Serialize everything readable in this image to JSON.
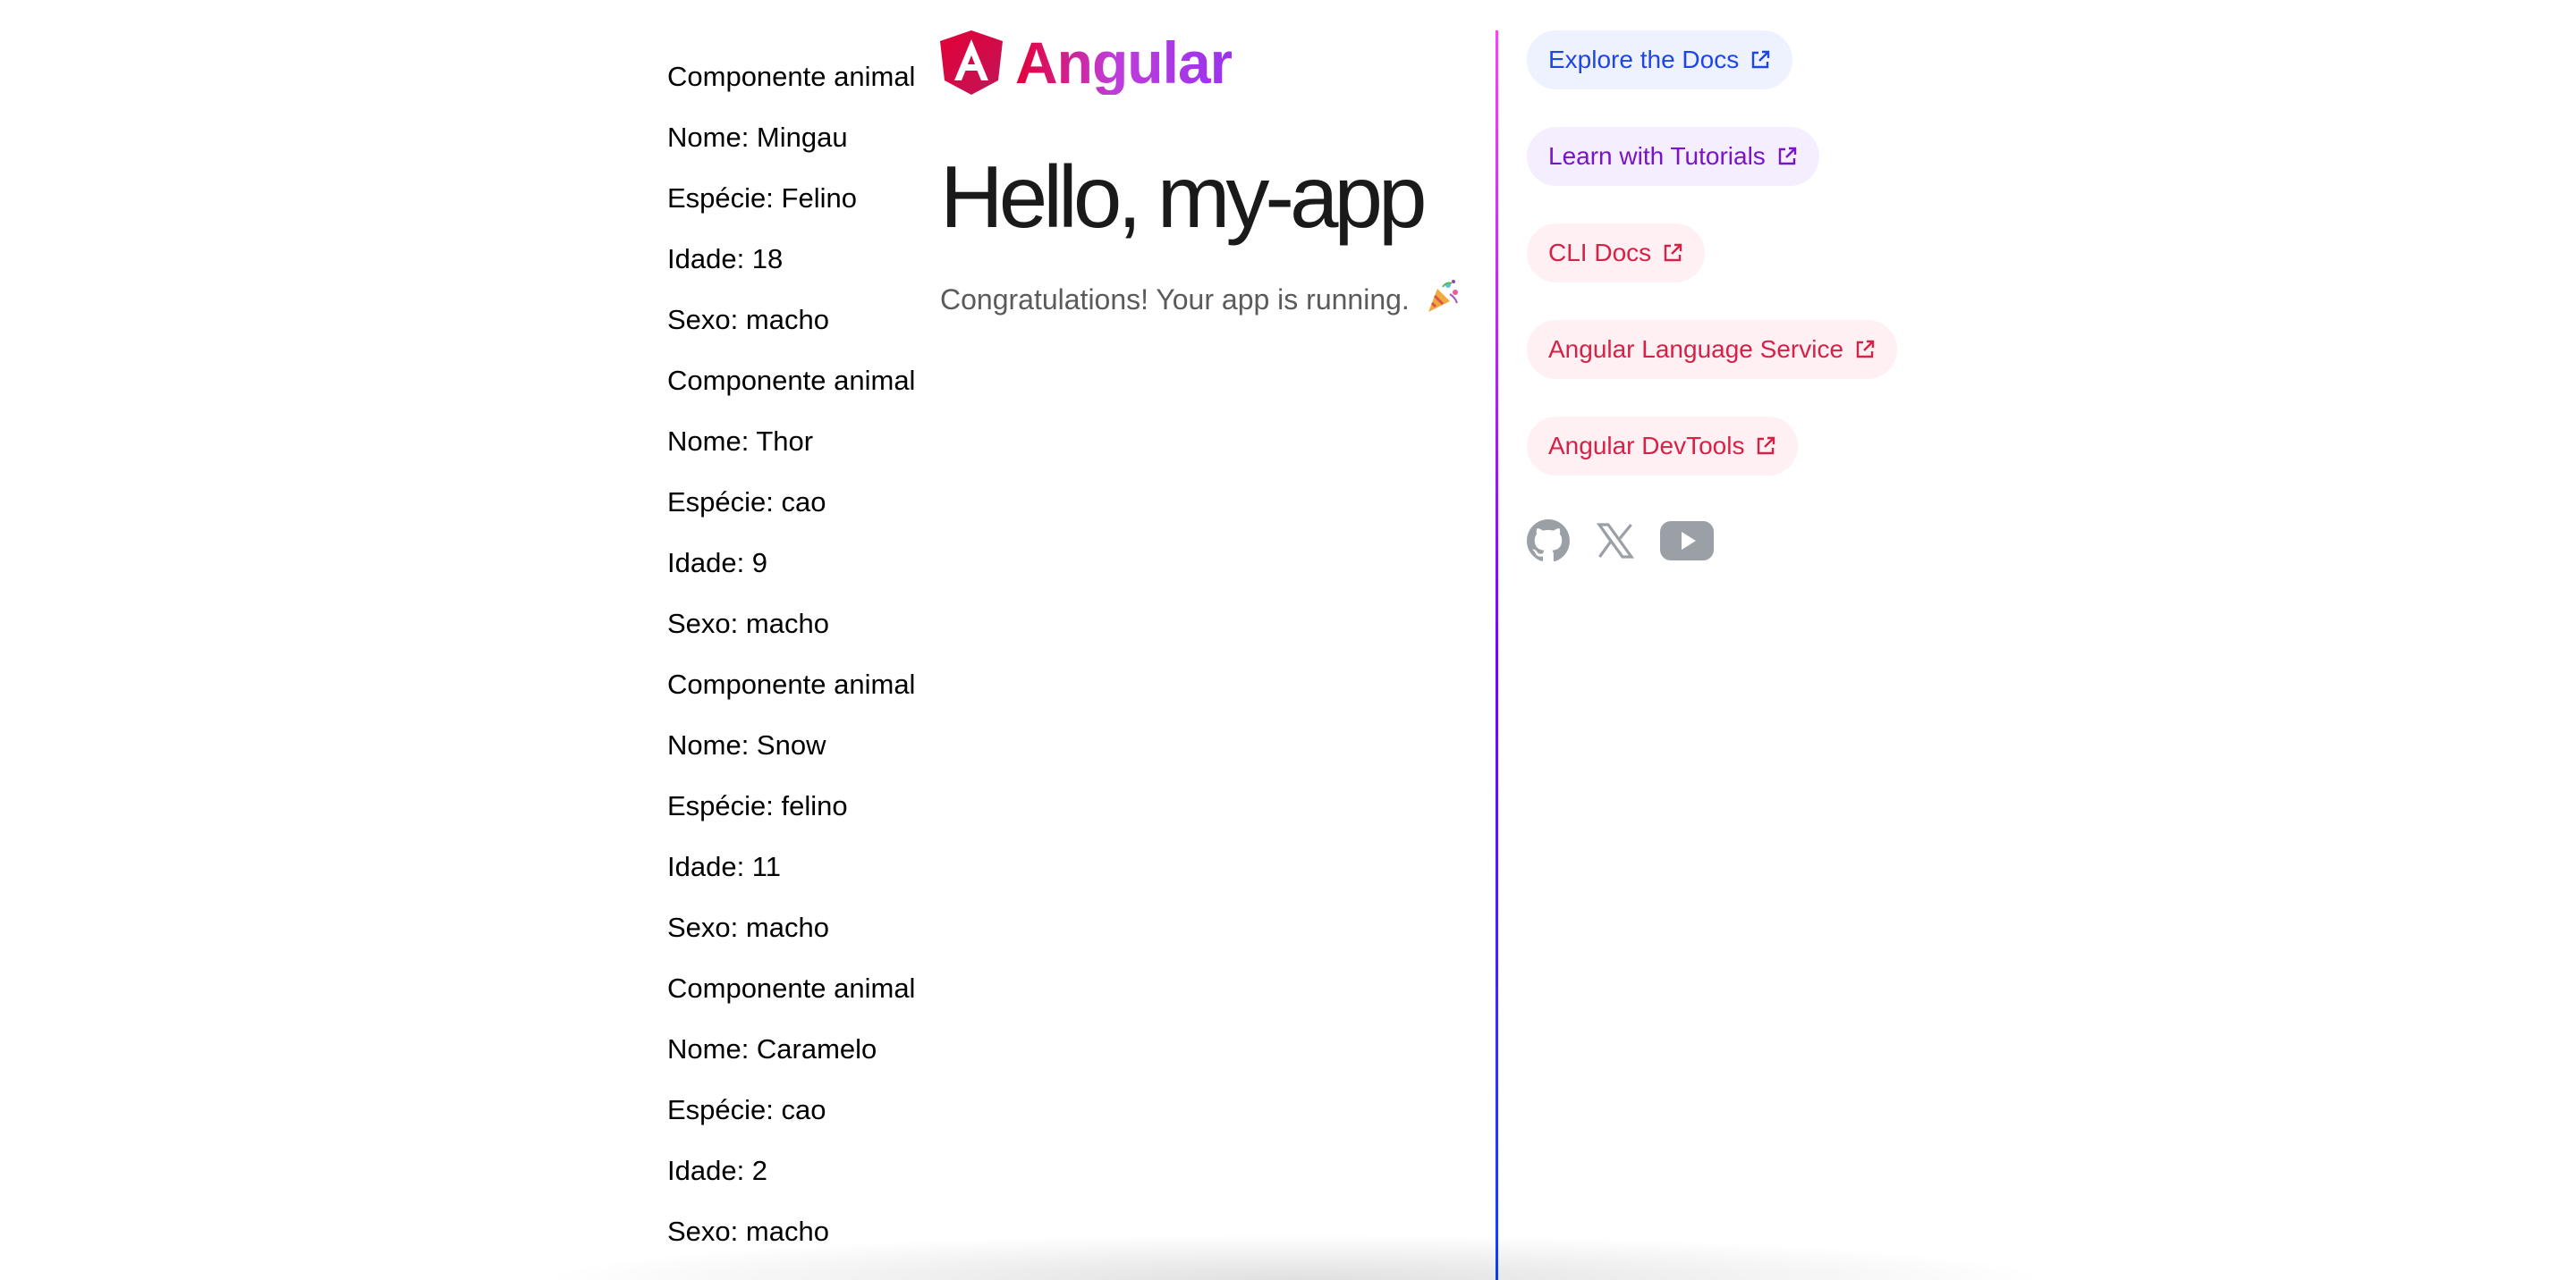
{
  "animals": [
    {
      "heading": "Componente animal",
      "name": "Nome: Mingau",
      "species": "Espécie: Felino",
      "age": "Idade: 18",
      "sex": "Sexo: macho"
    },
    {
      "heading": "Componente animal",
      "name": "Nome: Thor",
      "species": "Espécie: cao",
      "age": "Idade: 9",
      "sex": "Sexo: macho"
    },
    {
      "heading": "Componente animal",
      "name": "Nome: Snow",
      "species": "Espécie: felino",
      "age": "Idade: 11",
      "sex": "Sexo: macho"
    },
    {
      "heading": "Componente animal",
      "name": "Nome: Caramelo",
      "species": "Espécie: cao",
      "age": "Idade: 2",
      "sex": "Sexo: macho"
    }
  ],
  "logo": {
    "text": "Angular"
  },
  "main": {
    "title": "Hello, my-app",
    "subtitle": "Congratulations! Your app is running."
  },
  "links": [
    {
      "label": "Explore the Docs",
      "color": "#0546ff",
      "bg": "#eef2ff"
    },
    {
      "label": "Learn with Tutorials",
      "color": "#7702ff",
      "bg": "#f5eeff"
    },
    {
      "label": "CLI Docs",
      "color": "#f0060b",
      "bg": "#ffeef0"
    },
    {
      "label": "Angular Language Service",
      "color": "#f0060b",
      "bg": "#ffeef0"
    },
    {
      "label": "Angular DevTools",
      "color": "#f0060b",
      "bg": "#ffeef0"
    }
  ],
  "social": [
    "github-icon",
    "x-twitter-icon",
    "youtube-icon"
  ]
}
